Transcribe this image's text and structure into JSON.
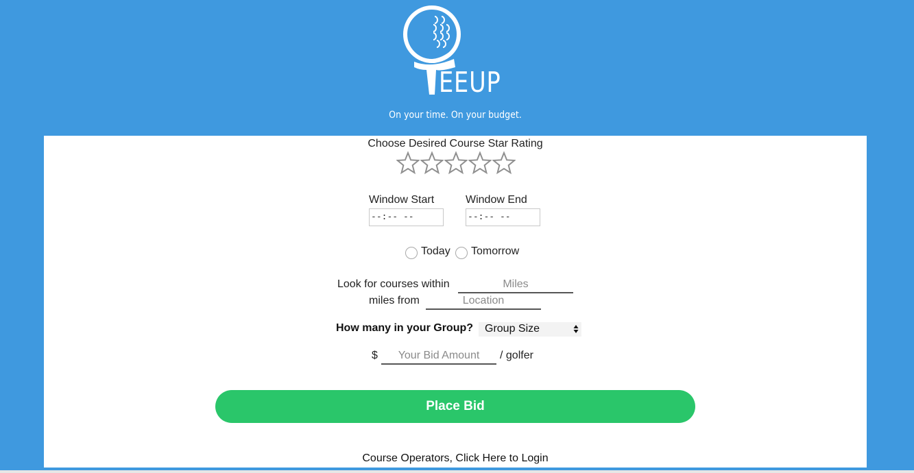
{
  "header": {
    "logo_text": "EEUP",
    "tagline": "On your time. On your budget."
  },
  "form": {
    "rating_label": "Choose Desired Course Star Rating",
    "rating_max": 5,
    "rating_selected": 0,
    "window_start_label": "Window Start",
    "window_start_value": "--:-- --",
    "window_end_label": "Window End",
    "window_end_value": "--:-- --",
    "day_options": [
      "Today",
      "Tomorrow"
    ],
    "look_within_label": "Look for courses within",
    "miles_placeholder": "Miles",
    "miles_from_label": "miles from",
    "location_placeholder": "Location",
    "group_label": "How many in your Group?",
    "group_select_value": "Group Size",
    "currency_symbol": "$",
    "bid_placeholder": "Your Bid Amount",
    "per_golfer_label": "/ golfer",
    "submit_label": "Place Bid",
    "login_link": "Course Operators, Click Here to Login"
  },
  "colors": {
    "background": "#3f99df",
    "button": "#2ac66a",
    "card": "#ffffff"
  }
}
